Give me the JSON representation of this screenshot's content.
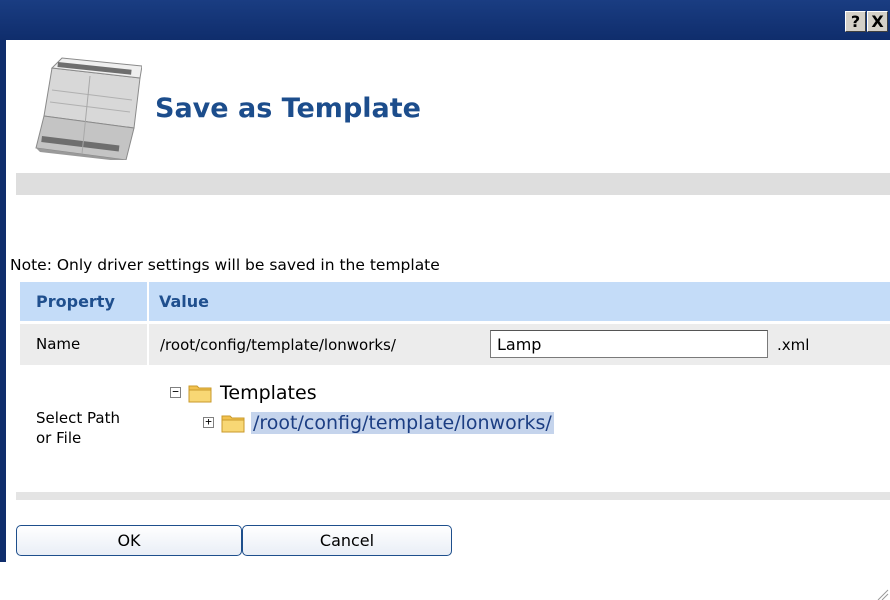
{
  "window": {
    "title_buttons": {
      "help": "?",
      "close": "X"
    },
    "frame_color": "#0f2d6c"
  },
  "header": {
    "title": "Save as Template",
    "icon": "device-module-icon"
  },
  "note": "Note: Only driver settings will be saved in the template",
  "table": {
    "headers": {
      "property": "Property",
      "value": "Value"
    },
    "name_row": {
      "label": "Name",
      "path_prefix": "/root/config/template/lonworks/",
      "input_value": "Lamp",
      "suffix": ".xml"
    },
    "select_row": {
      "label": "Select Path or File",
      "tree": {
        "root": {
          "toggle": "−",
          "label": "Templates",
          "icon": "folder-icon"
        },
        "child": {
          "toggle": "+",
          "label": "/root/config/template/lonworks/",
          "icon": "folder-icon",
          "selected": true
        }
      }
    }
  },
  "buttons": {
    "ok": "OK",
    "cancel": "Cancel"
  },
  "colors": {
    "title": "#1c4d8c",
    "header_bg": "#c4dcf8",
    "header_text": "#1f4f8e",
    "selection_bg": "#c5d4ec",
    "button_border": "#1e4f8c"
  }
}
